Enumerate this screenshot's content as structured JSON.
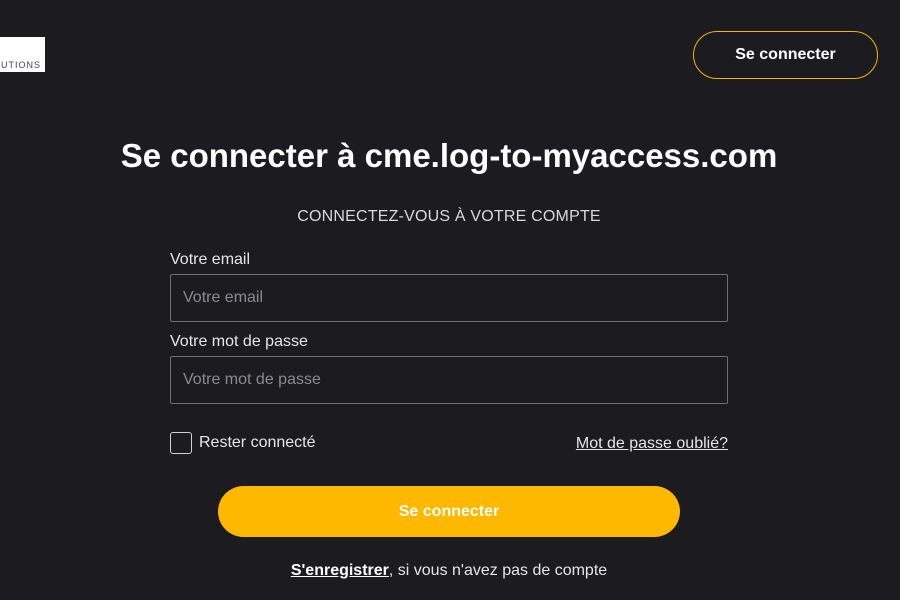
{
  "header": {
    "logo_text": "UTIONS",
    "login_button": "Se connecter"
  },
  "main": {
    "title": "Se connecter à cme.log-to-myaccess.com",
    "subtitle": "CONNECTEZ-VOUS À VOTRE COMPTE"
  },
  "form": {
    "email": {
      "label": "Votre email",
      "placeholder": "Votre email",
      "value": ""
    },
    "password": {
      "label": "Votre mot de passe",
      "placeholder": "Votre mot de passe",
      "value": ""
    },
    "remember_label": "Rester connecté",
    "remember_checked": false,
    "forgot_link": "Mot de passe oublié?",
    "submit_label": "Se connecter"
  },
  "footer": {
    "register_link": "S'enregistrer",
    "register_suffix": ", si vous n'avez pas de compte"
  },
  "colors": {
    "background": "#1c1b20",
    "accent": "#ffb800",
    "header_button_border": "#f4b400"
  }
}
